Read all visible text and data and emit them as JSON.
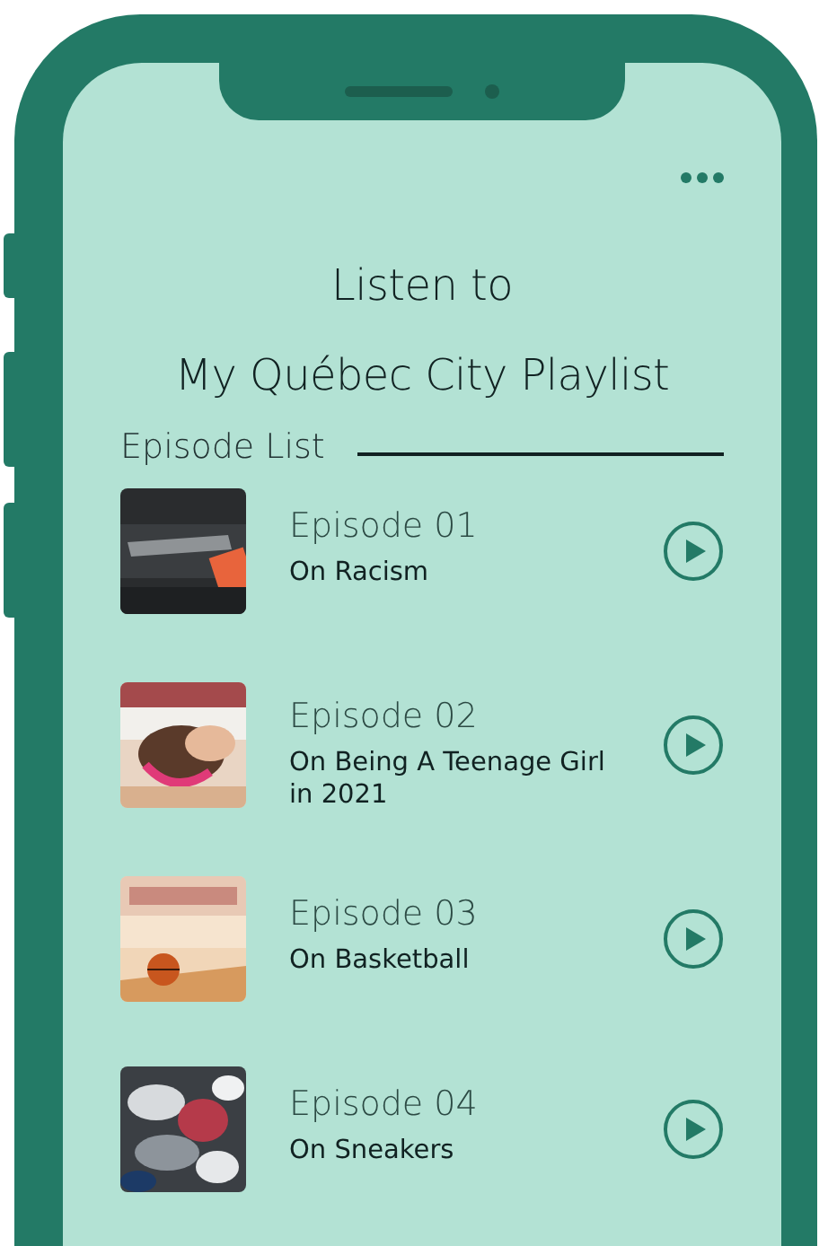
{
  "header": {
    "title_lines": [
      "Listen to",
      "My Québec City Playlist"
    ]
  },
  "section": {
    "label": "Episode List"
  },
  "episodes": [
    {
      "number": "Episode 01",
      "title": "On Racism"
    },
    {
      "number": "Episode 02",
      "title": "On Being A Teenage Girl in 2021"
    },
    {
      "number": "Episode 03",
      "title": "On Basketball"
    },
    {
      "number": "Episode 04",
      "title": "On Sneakers"
    }
  ]
}
